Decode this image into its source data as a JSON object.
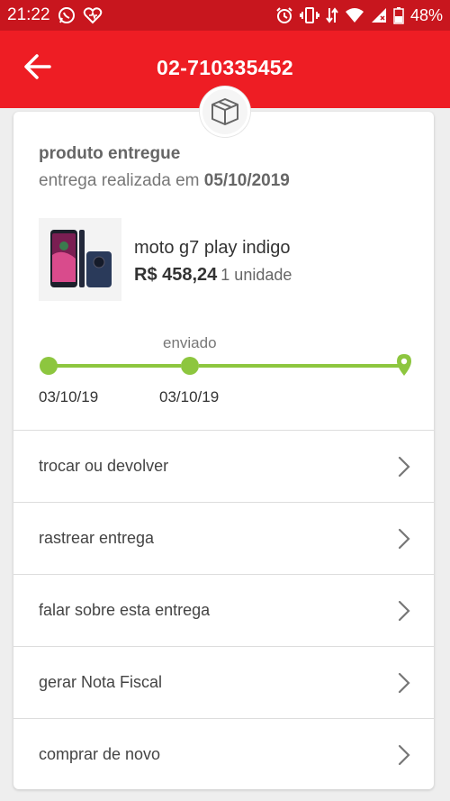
{
  "status_bar": {
    "time": "21:22",
    "battery": "48%",
    "left_icons": [
      "whatsapp-icon",
      "heart-notification-icon"
    ],
    "right_icons": [
      "alarm-icon",
      "vibrate-icon",
      "data-arrows-icon",
      "wifi-icon",
      "signal-icon",
      "battery-icon"
    ]
  },
  "header": {
    "title": "02-710335452",
    "back_icon": "arrow-left-icon"
  },
  "order": {
    "status_title": "produto entregue",
    "delivery_prefix": "entrega realizada em",
    "delivery_date": "05/10/2019"
  },
  "product": {
    "name": "moto g7 play indigo",
    "price": "R$ 458,24",
    "quantity": "1 unidade"
  },
  "timeline": {
    "label": "enviado",
    "start_date": "03/10/19",
    "middle_date": "03/10/19"
  },
  "menu": {
    "items": [
      {
        "label": "trocar ou devolver"
      },
      {
        "label": "rastrear entrega"
      },
      {
        "label": "falar sobre esta entrega"
      },
      {
        "label": "gerar Nota Fiscal"
      },
      {
        "label": "comprar de novo"
      }
    ]
  },
  "colors": {
    "status_bar": "#c8161e",
    "app_bar": "#ee1d24",
    "timeline": "#8dc63f",
    "background": "#eeeeee"
  }
}
